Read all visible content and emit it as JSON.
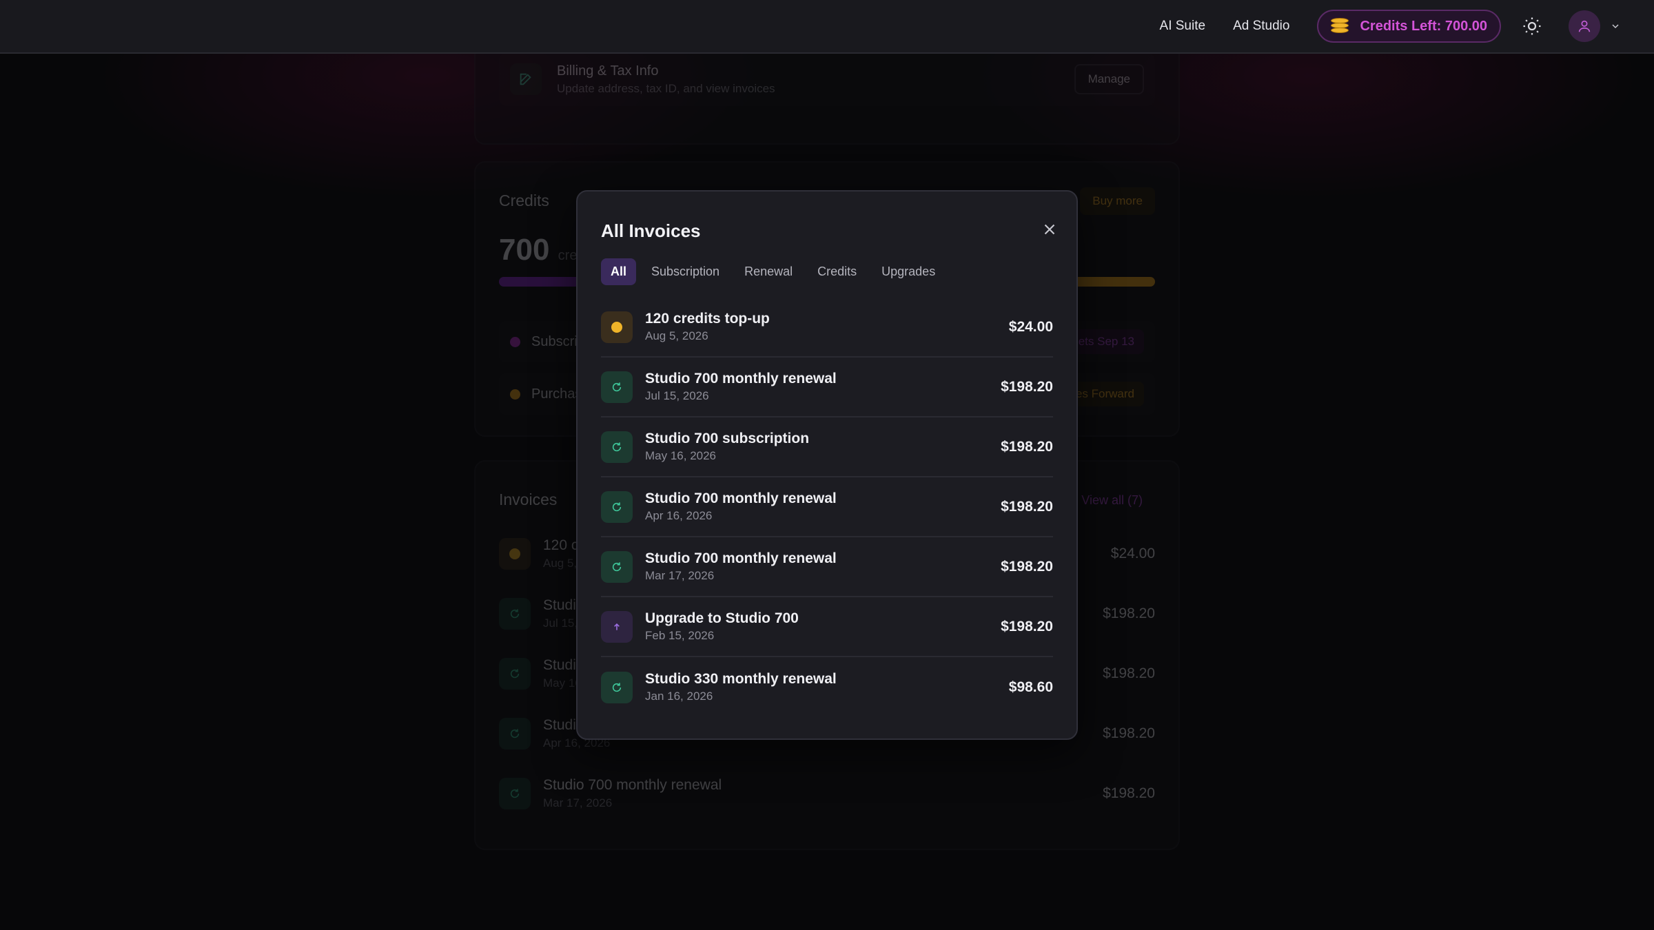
{
  "header": {
    "nav": [
      "AI Suite",
      "Ad Studio"
    ],
    "credits_label": "Credits Left: 700.00"
  },
  "background": {
    "billing": {
      "title": "Billing & Tax Info",
      "subtitle": "Update address, tax ID, and view invoices",
      "manage_label": "Manage"
    },
    "credits": {
      "title": "Credits",
      "buy_more_label": "Buy more",
      "amount": "700",
      "unit": "cred",
      "subscription_row": {
        "name": "Subscrip",
        "chip": "esets Sep 13"
      },
      "purchased_row": {
        "name": "Purchas",
        "chip": "ies Forward"
      }
    },
    "invoices": {
      "title": "Invoices",
      "view_all_label": "View all (7)",
      "rows": [
        {
          "title": "120 cr",
          "date": "Aug 5,",
          "amount": "$24.00"
        },
        {
          "title": "Studio",
          "date": "Jul 15,",
          "amount": "$198.20"
        },
        {
          "title": "Studio",
          "date": "May 16",
          "amount": "$198.20"
        },
        {
          "title": "Studio",
          "date": "Apr 16, 2026",
          "amount": "$198.20"
        },
        {
          "title": "Studio 700 monthly renewal",
          "date": "Mar 17, 2026",
          "amount": "$198.20"
        }
      ]
    }
  },
  "modal": {
    "title": "All Invoices",
    "tabs": [
      "All",
      "Subscription",
      "Renewal",
      "Credits",
      "Upgrades"
    ],
    "active_tab": "All",
    "invoices": [
      {
        "type": "topup",
        "icon": "coin-icon",
        "title": "120 credits top-up",
        "date": "Aug 5, 2026",
        "amount": "$24.00"
      },
      {
        "type": "renewal",
        "icon": "refresh-icon",
        "title": "Studio 700 monthly renewal",
        "date": "Jul 15, 2026",
        "amount": "$198.20"
      },
      {
        "type": "subscription",
        "icon": "refresh-icon",
        "title": "Studio 700 subscription",
        "date": "May 16, 2026",
        "amount": "$198.20"
      },
      {
        "type": "renewal",
        "icon": "refresh-icon",
        "title": "Studio 700 monthly renewal",
        "date": "Apr 16, 2026",
        "amount": "$198.20"
      },
      {
        "type": "renewal",
        "icon": "refresh-icon",
        "title": "Studio 700 monthly renewal",
        "date": "Mar 17, 2026",
        "amount": "$198.20"
      },
      {
        "type": "upgrade",
        "icon": "arrow-up-icon",
        "title": "Upgrade to Studio 700",
        "date": "Feb 15, 2026",
        "amount": "$198.20"
      },
      {
        "type": "renewal",
        "icon": "refresh-icon",
        "title": "Studio 330 monthly renewal",
        "date": "Jan 16, 2026",
        "amount": "$98.60"
      }
    ]
  },
  "colors": {
    "accent_purple": "#d454d8",
    "credits_gold": "#e8a11f",
    "renewal_green": "#3fc79a",
    "upgrade_purple": "#9b6ee0"
  }
}
